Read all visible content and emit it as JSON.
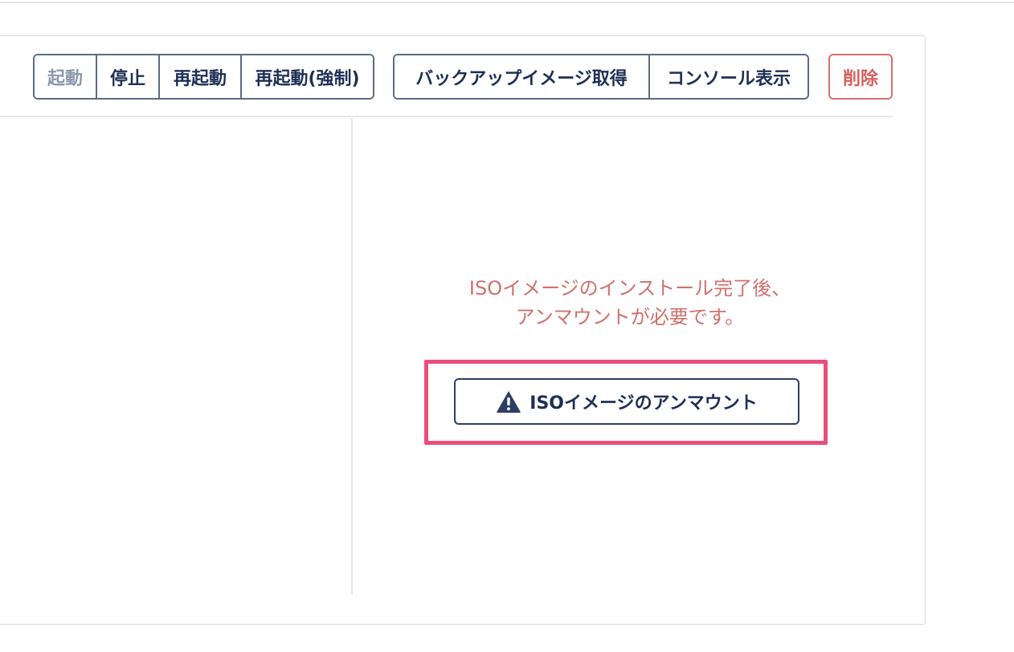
{
  "toolbar": {
    "power_group": {
      "start": "起動",
      "stop": "停止",
      "restart": "再起動",
      "force_restart": "再起動(強制)"
    },
    "misc_group": {
      "backup_image": "バックアップイメージ取得",
      "console": "コンソール表示"
    },
    "delete": "削除"
  },
  "notice": {
    "line1": "ISOイメージのインストール完了後、",
    "line2": "アンマウントが必要です。"
  },
  "unmount_button": {
    "label": "ISOイメージのアンマウント",
    "icon": "warning-triangle-icon"
  },
  "colors": {
    "primary_navy": "#1e2f55",
    "danger": "#d4605c",
    "highlight": "#ec4e79",
    "disabled_text": "#8a97ad"
  }
}
